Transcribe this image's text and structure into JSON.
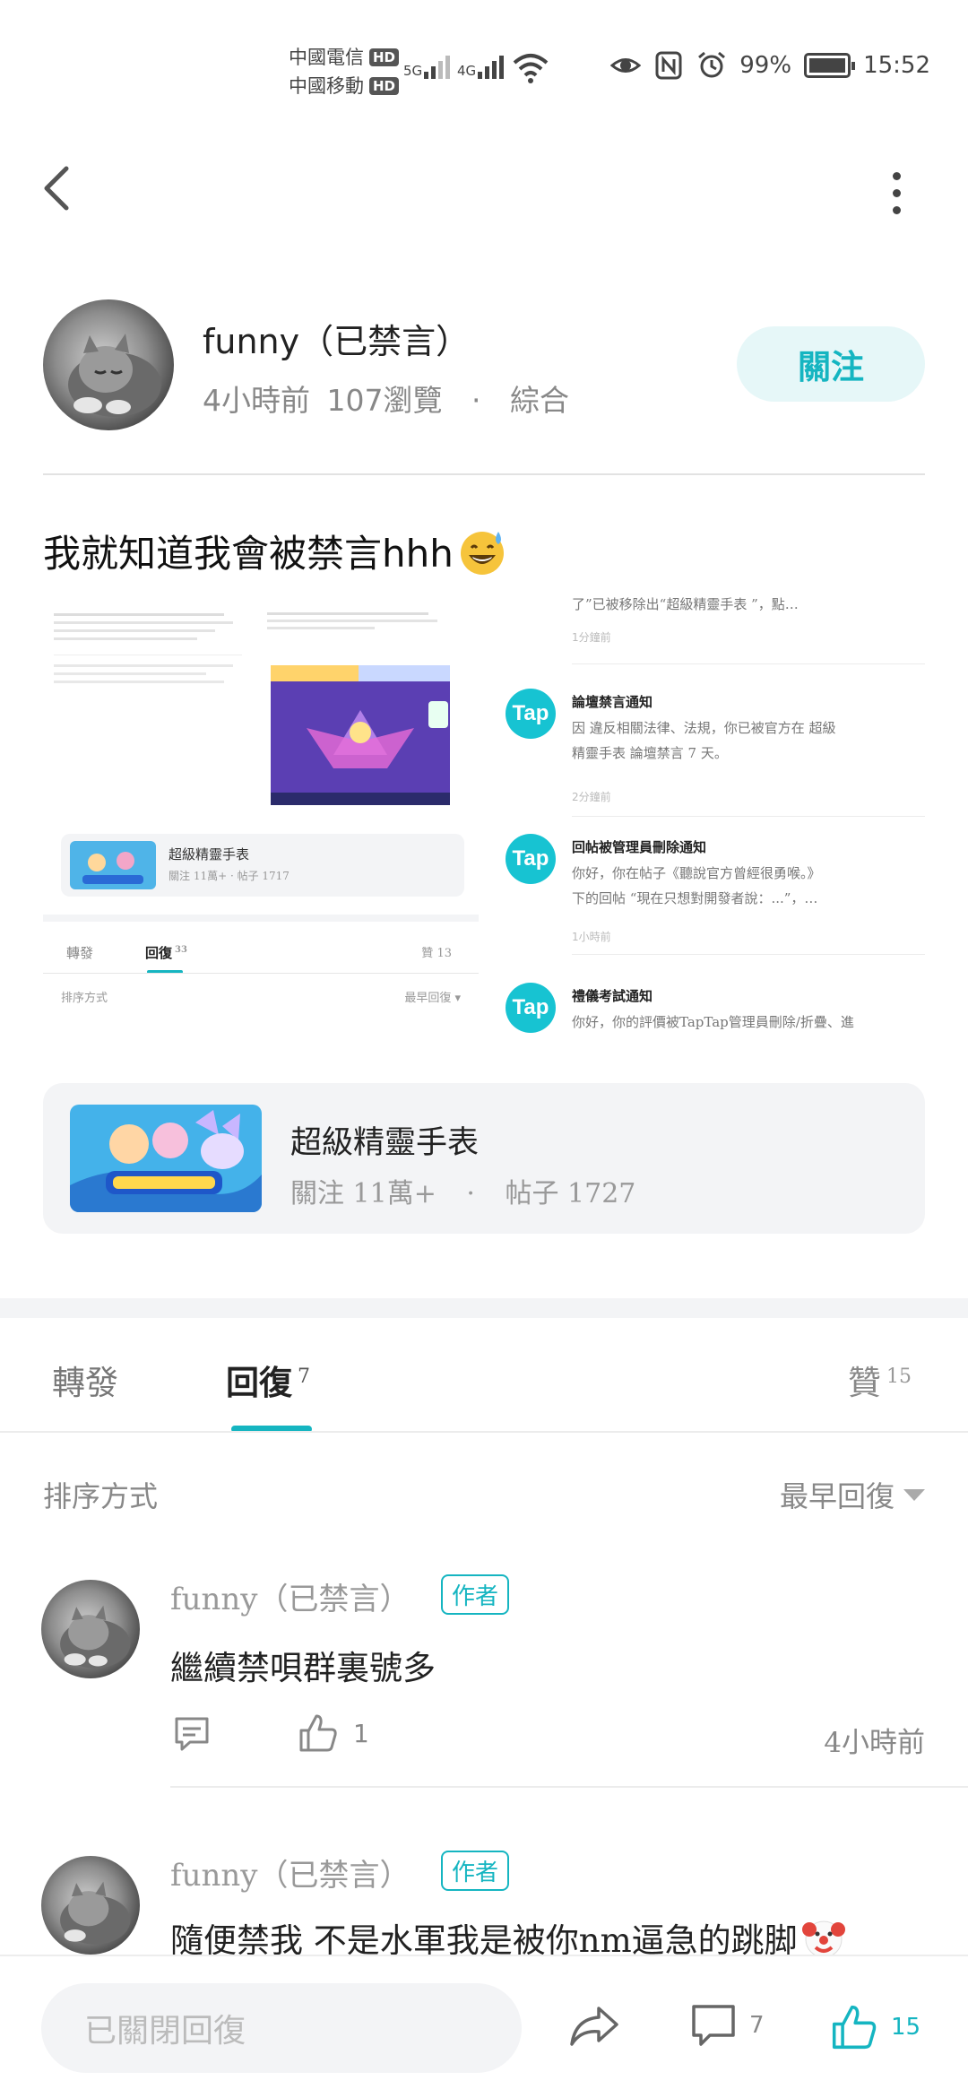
{
  "status_bar": {
    "carrier1": "中國電信",
    "carrier2": "中國移動",
    "hd": "HD",
    "net1": "5G",
    "net2": "4G",
    "battery": "99%",
    "time": "15:52"
  },
  "author": {
    "name": "funny（已禁言）",
    "time": "4小時前",
    "views": "107瀏覽",
    "separator": "·",
    "category": "綜合",
    "follow_label": "關注"
  },
  "post": {
    "title": "我就知道我會被禁言hhh"
  },
  "embedded_image": {
    "left": {
      "topic_name": "超級精靈手表",
      "topic_stats": "關注 11萬+ · 帖子 1717",
      "tab_repost": "轉發",
      "tab_reply": "回復",
      "tab_reply_count": "33",
      "tab_like": "贊",
      "tab_like_count": "13",
      "sort_label": "排序方式",
      "sort_value": "最早回復"
    },
    "right": {
      "top_line": "了​”已被移除出“超級精靈手表 ”，點…",
      "top_time": "1分鐘前",
      "notifications": [
        {
          "logo": "Tap",
          "title": "論壇禁言通知",
          "body1": "因 違反相關法律、法規，你已被官方在 超級",
          "body2": "精靈手表 論壇禁言 7 天。",
          "time": "2分鐘前"
        },
        {
          "logo": "Tap",
          "title": "回帖被管理員刪除通知",
          "body1": "你好，你在帖子《聽說官方曾經很勇喉。》",
          "body2": "下的回帖 “現在只想對開發者說：...”，…",
          "time": "1小時前"
        },
        {
          "logo": "Tap",
          "title": "禮儀考試通知",
          "body1": "你好，你的評價被TapTap管理員刪除/折疊、進",
          "body2": "",
          "time": ""
        }
      ]
    }
  },
  "game_card": {
    "name": "超級精靈手表",
    "follow": "關注 11萬+",
    "separator": "·",
    "posts": "帖子 1727"
  },
  "tabs": {
    "repost": "轉發",
    "reply": "回復",
    "reply_count": "7",
    "like": "贊",
    "like_count": "15"
  },
  "sort": {
    "label": "排序方式",
    "value": "最早回復"
  },
  "comments": [
    {
      "name": "funny（已禁言）",
      "badge": "作者",
      "text": "繼續禁唄群裏號多",
      "likes": "1",
      "time": "4小時前"
    },
    {
      "name": "funny（已禁言）",
      "badge": "作者",
      "text": "隨便禁我 不是水軍我是被你nm逼急的跳脚"
    }
  ],
  "bottom_bar": {
    "reply_placeholder": "已關閉回復",
    "comment_count": "7",
    "like_count": "15"
  },
  "colors": {
    "accent": "#15b5c1",
    "follow_bg": "#e6f7f8",
    "card_bg": "#f3f4f6",
    "muted_text": "#888888"
  }
}
